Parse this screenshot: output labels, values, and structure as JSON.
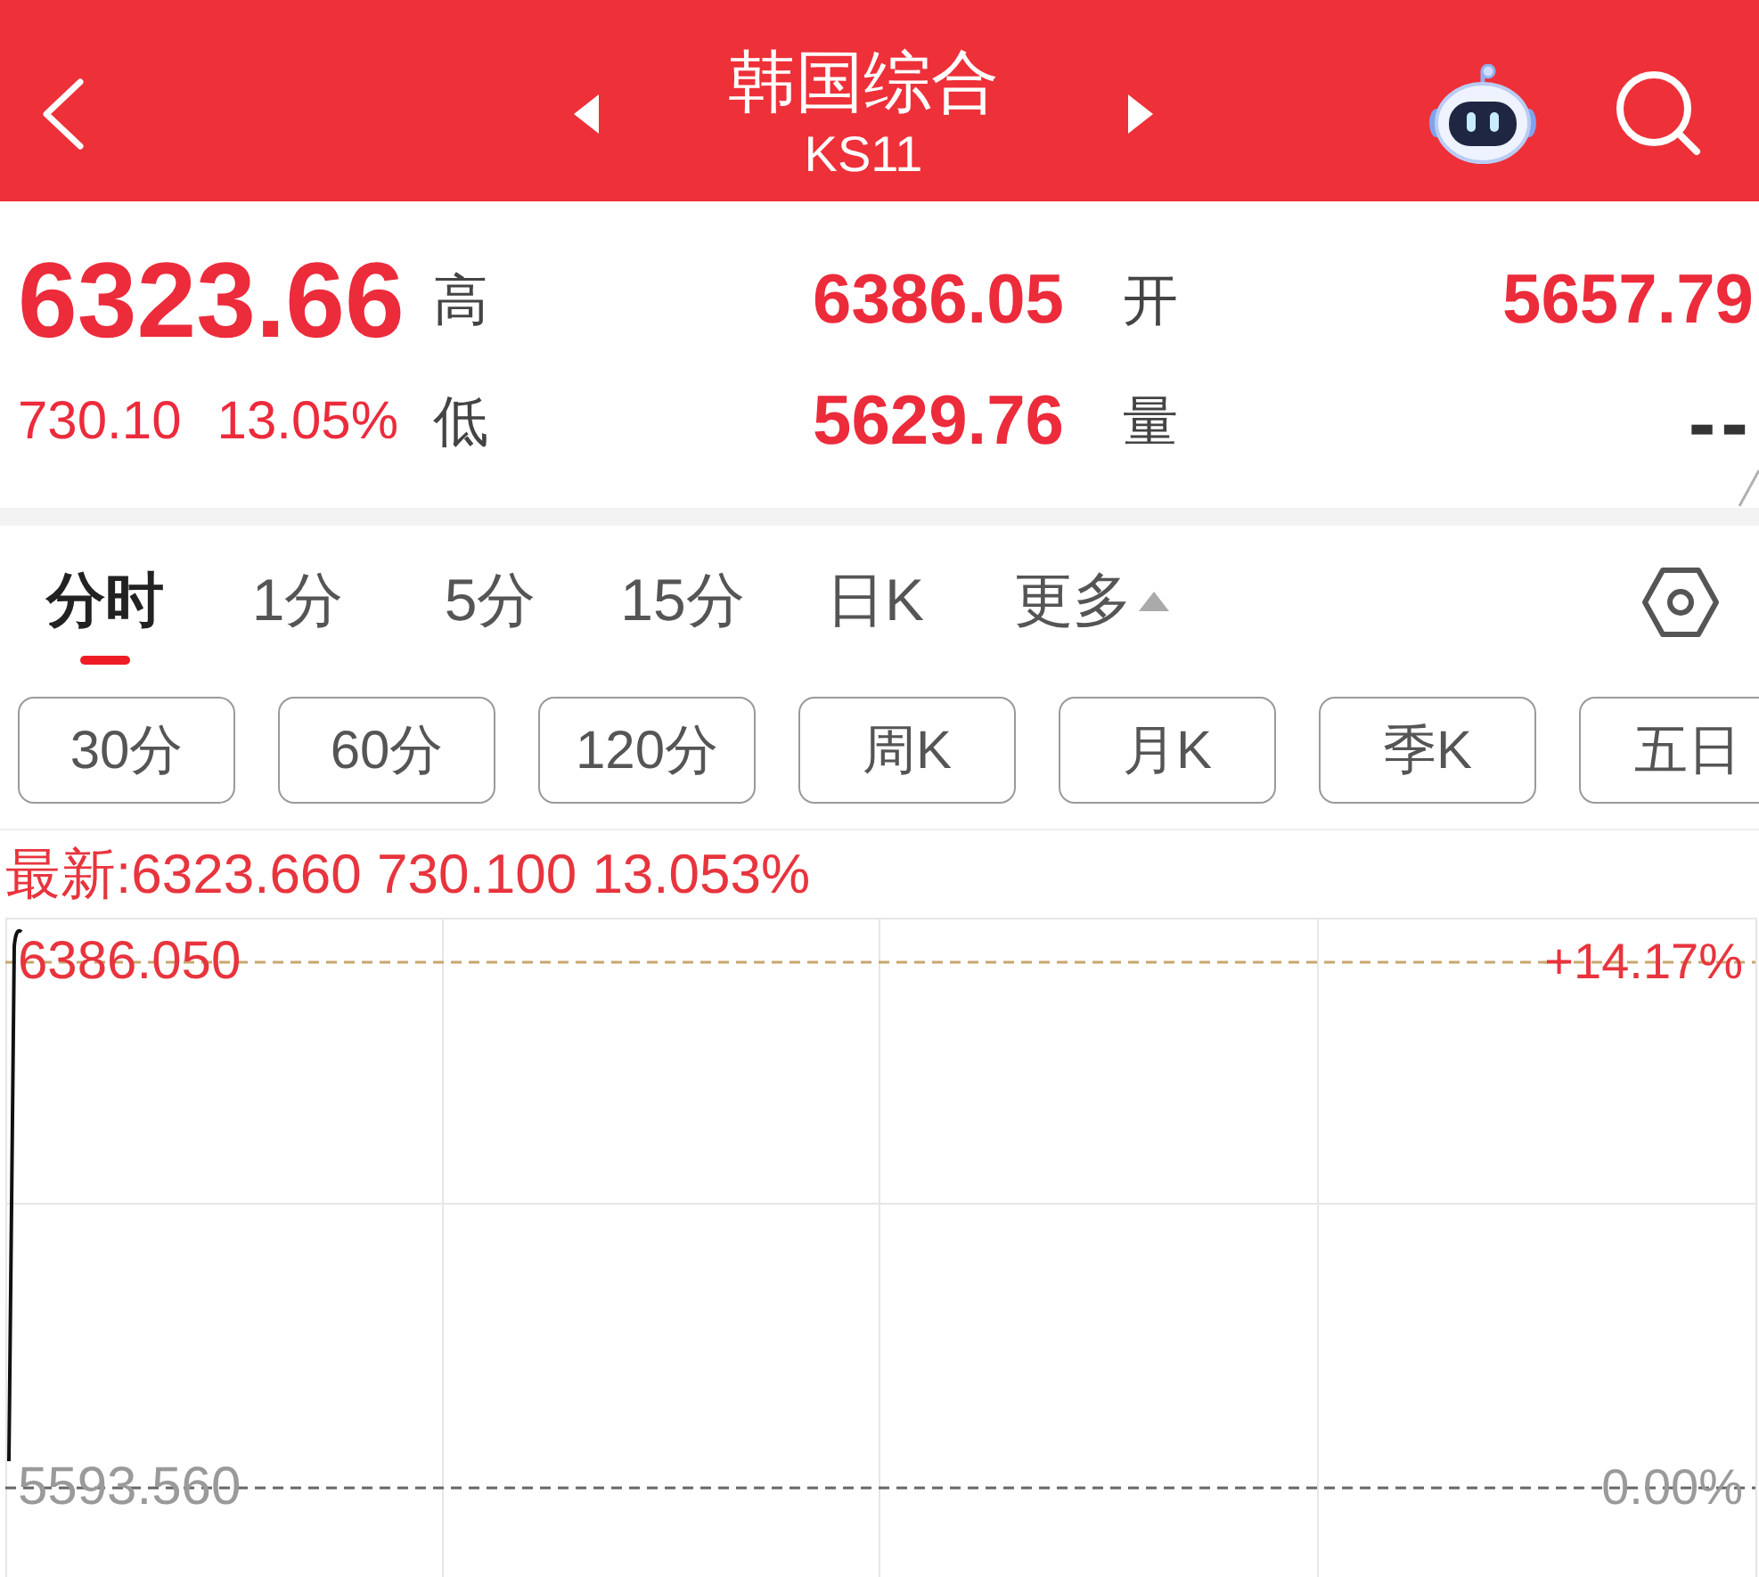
{
  "header": {
    "title": "韩国综合",
    "code": "KS11"
  },
  "quote": {
    "price": "6323.66",
    "change": "730.10",
    "change_percent": "13.05%",
    "stats": [
      {
        "label": "高",
        "value": "6386.05",
        "kind": "price"
      },
      {
        "label": "开",
        "value": "5657.79",
        "kind": "price"
      },
      {
        "label": "低",
        "value": "5629.76",
        "kind": "price"
      },
      {
        "label": "量",
        "value": "--",
        "kind": "volume"
      }
    ]
  },
  "period_tabs": [
    {
      "label": "分时",
      "kind": "period",
      "selected": true
    },
    {
      "label": "1分",
      "kind": "period",
      "selected": false
    },
    {
      "label": "5分",
      "kind": "period",
      "selected": false
    },
    {
      "label": "15分",
      "kind": "period",
      "selected": false
    },
    {
      "label": "日K",
      "kind": "period",
      "selected": false
    },
    {
      "label": "更多",
      "kind": "dropdown",
      "selected": false
    }
  ],
  "interval_buttons": [
    "30分",
    "60分",
    "120分",
    "周K",
    "月K",
    "季K",
    "五日"
  ],
  "chart": {
    "latest": "最新:6323.660 730.100 13.053%",
    "top_price": "6386.050",
    "top_percent": "+14.17%",
    "bottom_price": "5593.560",
    "bottom_percent": "0.00%"
  }
}
